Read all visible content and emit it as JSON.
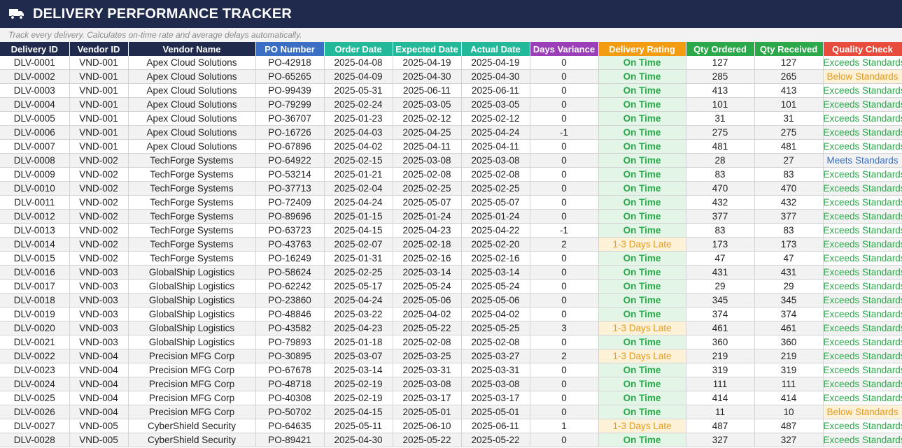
{
  "header": {
    "title": "DELIVERY PERFORMANCE TRACKER",
    "subtitle": "Track every delivery. Calculates on-time rate and average delays automatically.",
    "icon": "truck-icon"
  },
  "colors": {
    "title_bg": "#1f2a4d",
    "col_navy": "#1f2a4d",
    "col_blue": "#3a6fc4",
    "col_teal": "#21b999",
    "col_purple": "#9b3fb8",
    "col_orange": "#f39c12",
    "col_green": "#2aa84a",
    "col_red": "#e74c3c"
  },
  "table": {
    "columns": [
      {
        "label": "Delivery ID",
        "color": "#1f2a4d"
      },
      {
        "label": "Vendor ID",
        "color": "#1f2a4d"
      },
      {
        "label": "Vendor Name",
        "color": "#1f2a4d"
      },
      {
        "label": "PO Number",
        "color": "#3a6fc4"
      },
      {
        "label": "Order Date",
        "color": "#21b999"
      },
      {
        "label": "Expected Date",
        "color": "#21b999"
      },
      {
        "label": "Actual Date",
        "color": "#21b999"
      },
      {
        "label": "Days Variance",
        "color": "#9b3fb8"
      },
      {
        "label": "Delivery Rating",
        "color": "#f39c12"
      },
      {
        "label": "Qty Ordered",
        "color": "#2aa84a"
      },
      {
        "label": "Qty Received",
        "color": "#2aa84a"
      },
      {
        "label": "Quality Check",
        "color": "#e74c3c"
      }
    ],
    "rows": [
      [
        "DLV-0001",
        "VND-001",
        "Apex Cloud Solutions",
        "PO-42918",
        "2025-04-08",
        "2025-04-19",
        "2025-04-19",
        "0",
        "On Time",
        "127",
        "127",
        "Exceeds Standards"
      ],
      [
        "DLV-0002",
        "VND-001",
        "Apex Cloud Solutions",
        "PO-65265",
        "2025-04-09",
        "2025-04-30",
        "2025-04-30",
        "0",
        "On Time",
        "285",
        "265",
        "Below Standards"
      ],
      [
        "DLV-0003",
        "VND-001",
        "Apex Cloud Solutions",
        "PO-99439",
        "2025-05-31",
        "2025-06-11",
        "2025-06-11",
        "0",
        "On Time",
        "413",
        "413",
        "Exceeds Standards"
      ],
      [
        "DLV-0004",
        "VND-001",
        "Apex Cloud Solutions",
        "PO-79299",
        "2025-02-24",
        "2025-03-05",
        "2025-03-05",
        "0",
        "On Time",
        "101",
        "101",
        "Exceeds Standards"
      ],
      [
        "DLV-0005",
        "VND-001",
        "Apex Cloud Solutions",
        "PO-36707",
        "2025-01-23",
        "2025-02-12",
        "2025-02-12",
        "0",
        "On Time",
        "31",
        "31",
        "Exceeds Standards"
      ],
      [
        "DLV-0006",
        "VND-001",
        "Apex Cloud Solutions",
        "PO-16726",
        "2025-04-03",
        "2025-04-25",
        "2025-04-24",
        "-1",
        "On Time",
        "275",
        "275",
        "Exceeds Standards"
      ],
      [
        "DLV-0007",
        "VND-001",
        "Apex Cloud Solutions",
        "PO-67896",
        "2025-04-02",
        "2025-04-11",
        "2025-04-11",
        "0",
        "On Time",
        "481",
        "481",
        "Exceeds Standards"
      ],
      [
        "DLV-0008",
        "VND-002",
        "TechForge Systems",
        "PO-64922",
        "2025-02-15",
        "2025-03-08",
        "2025-03-08",
        "0",
        "On Time",
        "28",
        "27",
        "Meets Standards"
      ],
      [
        "DLV-0009",
        "VND-002",
        "TechForge Systems",
        "PO-53214",
        "2025-01-21",
        "2025-02-08",
        "2025-02-08",
        "0",
        "On Time",
        "83",
        "83",
        "Exceeds Standards"
      ],
      [
        "DLV-0010",
        "VND-002",
        "TechForge Systems",
        "PO-37713",
        "2025-02-04",
        "2025-02-25",
        "2025-02-25",
        "0",
        "On Time",
        "470",
        "470",
        "Exceeds Standards"
      ],
      [
        "DLV-0011",
        "VND-002",
        "TechForge Systems",
        "PO-72409",
        "2025-04-24",
        "2025-05-07",
        "2025-05-07",
        "0",
        "On Time",
        "432",
        "432",
        "Exceeds Standards"
      ],
      [
        "DLV-0012",
        "VND-002",
        "TechForge Systems",
        "PO-89696",
        "2025-01-15",
        "2025-01-24",
        "2025-01-24",
        "0",
        "On Time",
        "377",
        "377",
        "Exceeds Standards"
      ],
      [
        "DLV-0013",
        "VND-002",
        "TechForge Systems",
        "PO-63723",
        "2025-04-15",
        "2025-04-23",
        "2025-04-22",
        "-1",
        "On Time",
        "83",
        "83",
        "Exceeds Standards"
      ],
      [
        "DLV-0014",
        "VND-002",
        "TechForge Systems",
        "PO-43763",
        "2025-02-07",
        "2025-02-18",
        "2025-02-20",
        "2",
        "1-3 Days Late",
        "173",
        "173",
        "Exceeds Standards"
      ],
      [
        "DLV-0015",
        "VND-002",
        "TechForge Systems",
        "PO-16249",
        "2025-01-31",
        "2025-02-16",
        "2025-02-16",
        "0",
        "On Time",
        "47",
        "47",
        "Exceeds Standards"
      ],
      [
        "DLV-0016",
        "VND-003",
        "GlobalShip Logistics",
        "PO-58624",
        "2025-02-25",
        "2025-03-14",
        "2025-03-14",
        "0",
        "On Time",
        "431",
        "431",
        "Exceeds Standards"
      ],
      [
        "DLV-0017",
        "VND-003",
        "GlobalShip Logistics",
        "PO-62242",
        "2025-05-17",
        "2025-05-24",
        "2025-05-24",
        "0",
        "On Time",
        "29",
        "29",
        "Exceeds Standards"
      ],
      [
        "DLV-0018",
        "VND-003",
        "GlobalShip Logistics",
        "PO-23860",
        "2025-04-24",
        "2025-05-06",
        "2025-05-06",
        "0",
        "On Time",
        "345",
        "345",
        "Exceeds Standards"
      ],
      [
        "DLV-0019",
        "VND-003",
        "GlobalShip Logistics",
        "PO-48846",
        "2025-03-22",
        "2025-04-02",
        "2025-04-02",
        "0",
        "On Time",
        "374",
        "374",
        "Exceeds Standards"
      ],
      [
        "DLV-0020",
        "VND-003",
        "GlobalShip Logistics",
        "PO-43582",
        "2025-04-23",
        "2025-05-22",
        "2025-05-25",
        "3",
        "1-3 Days Late",
        "461",
        "461",
        "Exceeds Standards"
      ],
      [
        "DLV-0021",
        "VND-003",
        "GlobalShip Logistics",
        "PO-79893",
        "2025-01-18",
        "2025-02-08",
        "2025-02-08",
        "0",
        "On Time",
        "360",
        "360",
        "Exceeds Standards"
      ],
      [
        "DLV-0022",
        "VND-004",
        "Precision MFG Corp",
        "PO-30895",
        "2025-03-07",
        "2025-03-25",
        "2025-03-27",
        "2",
        "1-3 Days Late",
        "219",
        "219",
        "Exceeds Standards"
      ],
      [
        "DLV-0023",
        "VND-004",
        "Precision MFG Corp",
        "PO-67678",
        "2025-03-14",
        "2025-03-31",
        "2025-03-31",
        "0",
        "On Time",
        "319",
        "319",
        "Exceeds Standards"
      ],
      [
        "DLV-0024",
        "VND-004",
        "Precision MFG Corp",
        "PO-48718",
        "2025-02-19",
        "2025-03-08",
        "2025-03-08",
        "0",
        "On Time",
        "111",
        "111",
        "Exceeds Standards"
      ],
      [
        "DLV-0025",
        "VND-004",
        "Precision MFG Corp",
        "PO-40308",
        "2025-02-19",
        "2025-03-17",
        "2025-03-17",
        "0",
        "On Time",
        "414",
        "414",
        "Exceeds Standards"
      ],
      [
        "DLV-0026",
        "VND-004",
        "Precision MFG Corp",
        "PO-50702",
        "2025-04-15",
        "2025-05-01",
        "2025-05-01",
        "0",
        "On Time",
        "11",
        "10",
        "Below Standards"
      ],
      [
        "DLV-0027",
        "VND-005",
        "CyberShield Security",
        "PO-64635",
        "2025-05-11",
        "2025-06-10",
        "2025-06-11",
        "1",
        "1-3 Days Late",
        "487",
        "487",
        "Exceeds Standards"
      ],
      [
        "DLV-0028",
        "VND-005",
        "CyberShield Security",
        "PO-89421",
        "2025-04-30",
        "2025-05-22",
        "2025-05-22",
        "0",
        "On Time",
        "327",
        "327",
        "Exceeds Standards"
      ]
    ]
  }
}
